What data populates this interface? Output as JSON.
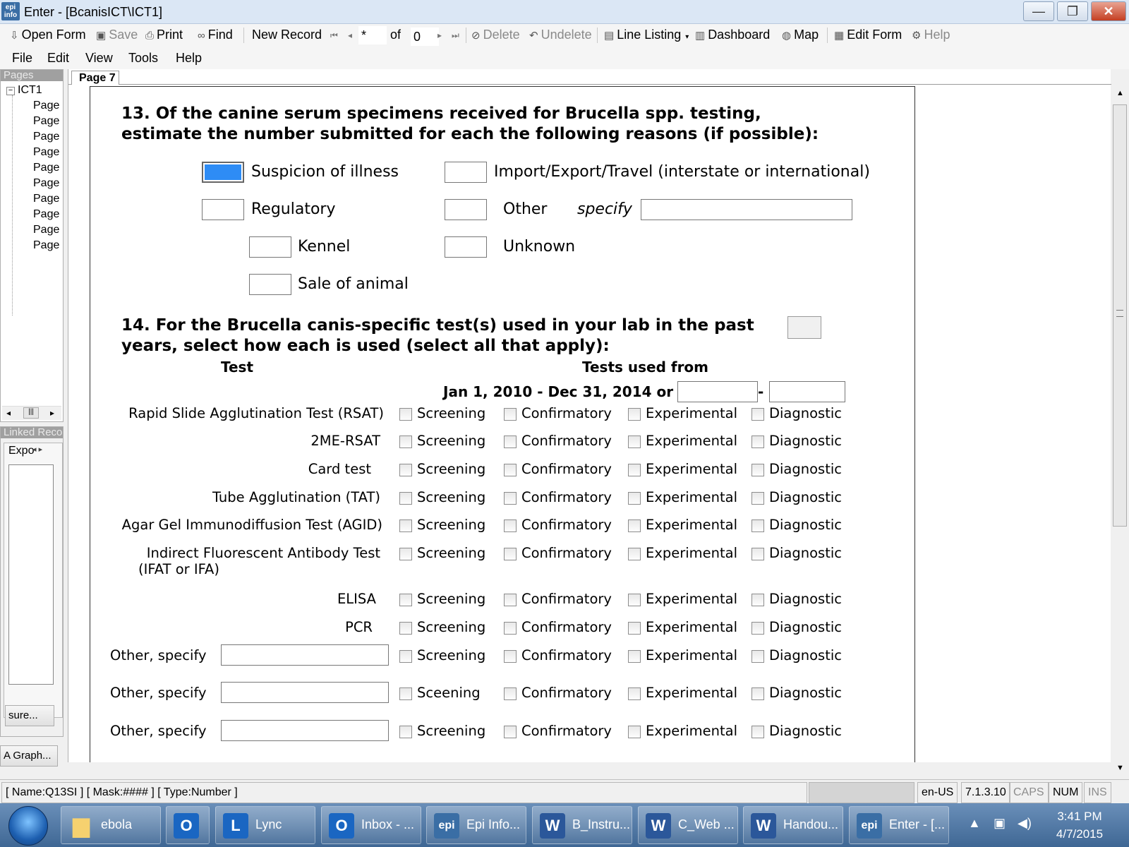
{
  "window": {
    "title": "Enter - [BcanisICT\\ICT1]",
    "app_icon_text": "epi info",
    "minimize_glyph": "—",
    "maximize_glyph": "❐",
    "close_glyph": "✕"
  },
  "toolbar": {
    "open_form": "Open Form",
    "save": "Save",
    "print": "Print",
    "find": "Find",
    "new_record": "New Record",
    "record_current": "*",
    "of_label": "of",
    "record_total": "0",
    "delete": "Delete",
    "undelete": "Undelete",
    "line_listing": "Line Listing",
    "dashboard": "Dashboard",
    "map": "Map",
    "edit_form": "Edit Form",
    "help": "Help"
  },
  "menu": [
    "File",
    "Edit",
    "View",
    "Tools",
    "Help"
  ],
  "pages_panel": {
    "title": "Pages",
    "root": "ICT1",
    "items": [
      "Page",
      "Page",
      "Page",
      "Page",
      "Page",
      "Page",
      "Page",
      "Page",
      "Page",
      "Page"
    ]
  },
  "linked_panel": {
    "title": "Linked Reco",
    "tab": "Expo",
    "button1": "sure...",
    "button2": "A Graph..."
  },
  "page_tab": "Page 7",
  "q13": {
    "line1": "13. Of the canine serum specimens received for Brucella spp. testing,",
    "line2": "estimate the number submitted for each the following reasons (if possible):",
    "options": {
      "suspicion": "Suspicion of illness",
      "regulatory": "Regulatory",
      "kennel": "Kennel",
      "sale": "Sale of animal",
      "import": "Import/Export/Travel (interstate or international)",
      "other": "Other",
      "specify": "specify",
      "unknown": "Unknown"
    }
  },
  "q14": {
    "line1": "14. For the Brucella canis-specific test(s) used in your lab in the past",
    "line2": "years, select how each is used (select all that apply):",
    "col_test": "Test",
    "col_used": "Tests used from",
    "date_range": "Jan 1, 2010 - Dec 31, 2014 or",
    "dash": "-",
    "rows": [
      {
        "test": "Rapid Slide Agglutination Test (RSAT)",
        "opts": [
          "Screening",
          "Confirmatory",
          "Experimental",
          "Diagnostic"
        ]
      },
      {
        "test": "2ME-RSAT",
        "opts": [
          "Screening",
          "Confirmatory",
          "Experimental",
          "Diagnostic"
        ]
      },
      {
        "test": "Card test",
        "opts": [
          "Screening",
          "Confirmatory",
          "Experimental",
          "Diagnostic"
        ]
      },
      {
        "test": "Tube Agglutination (TAT)",
        "opts": [
          "Screening",
          "Confirmatory",
          "Experimental",
          "Diagnostic"
        ]
      },
      {
        "test": "Agar Gel Immunodiffusion Test (AGID)",
        "opts": [
          "Screening",
          "Confirmatory",
          "Experimental",
          "Diagnostic"
        ]
      },
      {
        "test": "Indirect Fluorescent Antibody Test",
        "test2": "(IFAT or IFA)",
        "opts": [
          "Screening",
          "Confirmatory",
          "Experimental",
          "Diagnostic"
        ]
      },
      {
        "test": "ELISA",
        "opts": [
          "Screening",
          "Confirmatory",
          "Experimental",
          "Diagnostic"
        ]
      },
      {
        "test": "PCR",
        "opts": [
          "Screening",
          "Confirmatory",
          "Experimental",
          "Diagnostic"
        ]
      },
      {
        "test": "Other, specify",
        "opts": [
          "Screening",
          "Confirmatory",
          "Experimental",
          "Diagnostic"
        ]
      },
      {
        "test": "Other, specify",
        "opts": [
          "Sceening",
          "Confirmatory",
          "Experimental",
          "Diagnostic"
        ]
      },
      {
        "test": "Other, specify",
        "opts": [
          "Screening",
          "Confirmatory",
          "Experimental",
          "Diagnostic"
        ]
      }
    ]
  },
  "status": {
    "field": "[ Name:Q13SI ] [ Mask:#### ] [ Type:Number ]",
    "locale": "en-US",
    "version": "7.1.3.10",
    "caps": "CAPS",
    "num": "NUM",
    "ins": "INS"
  },
  "taskbar": {
    "items": [
      {
        "label": "ebola",
        "icon": "folder-icon",
        "color": "#e8b84a"
      },
      {
        "label": "",
        "icon": "outlook-icon",
        "color": "#1a66c2"
      },
      {
        "label": "Lync",
        "icon": "lync-icon",
        "color": "#1a66c2"
      },
      {
        "label": "Inbox - ...",
        "icon": "outlook-icon",
        "color": "#1a66c2"
      },
      {
        "label": "Epi Info...",
        "icon": "epi-info-icon",
        "color": "#3a6ea5"
      },
      {
        "label": "B_Instru...",
        "icon": "word-icon",
        "color": "#2b579a"
      },
      {
        "label": "C_Web ...",
        "icon": "word-icon",
        "color": "#2b579a"
      },
      {
        "label": "Handou...",
        "icon": "word-icon",
        "color": "#2b579a"
      },
      {
        "label": "Enter - [...",
        "icon": "epi-info-icon",
        "color": "#3a6ea5"
      }
    ],
    "time": "3:41 PM",
    "date": "4/7/2015"
  },
  "colors": {
    "selected_field": "#2e8cf5",
    "titlebar": "#dbe7f5",
    "taskbar": "#3f6794"
  }
}
